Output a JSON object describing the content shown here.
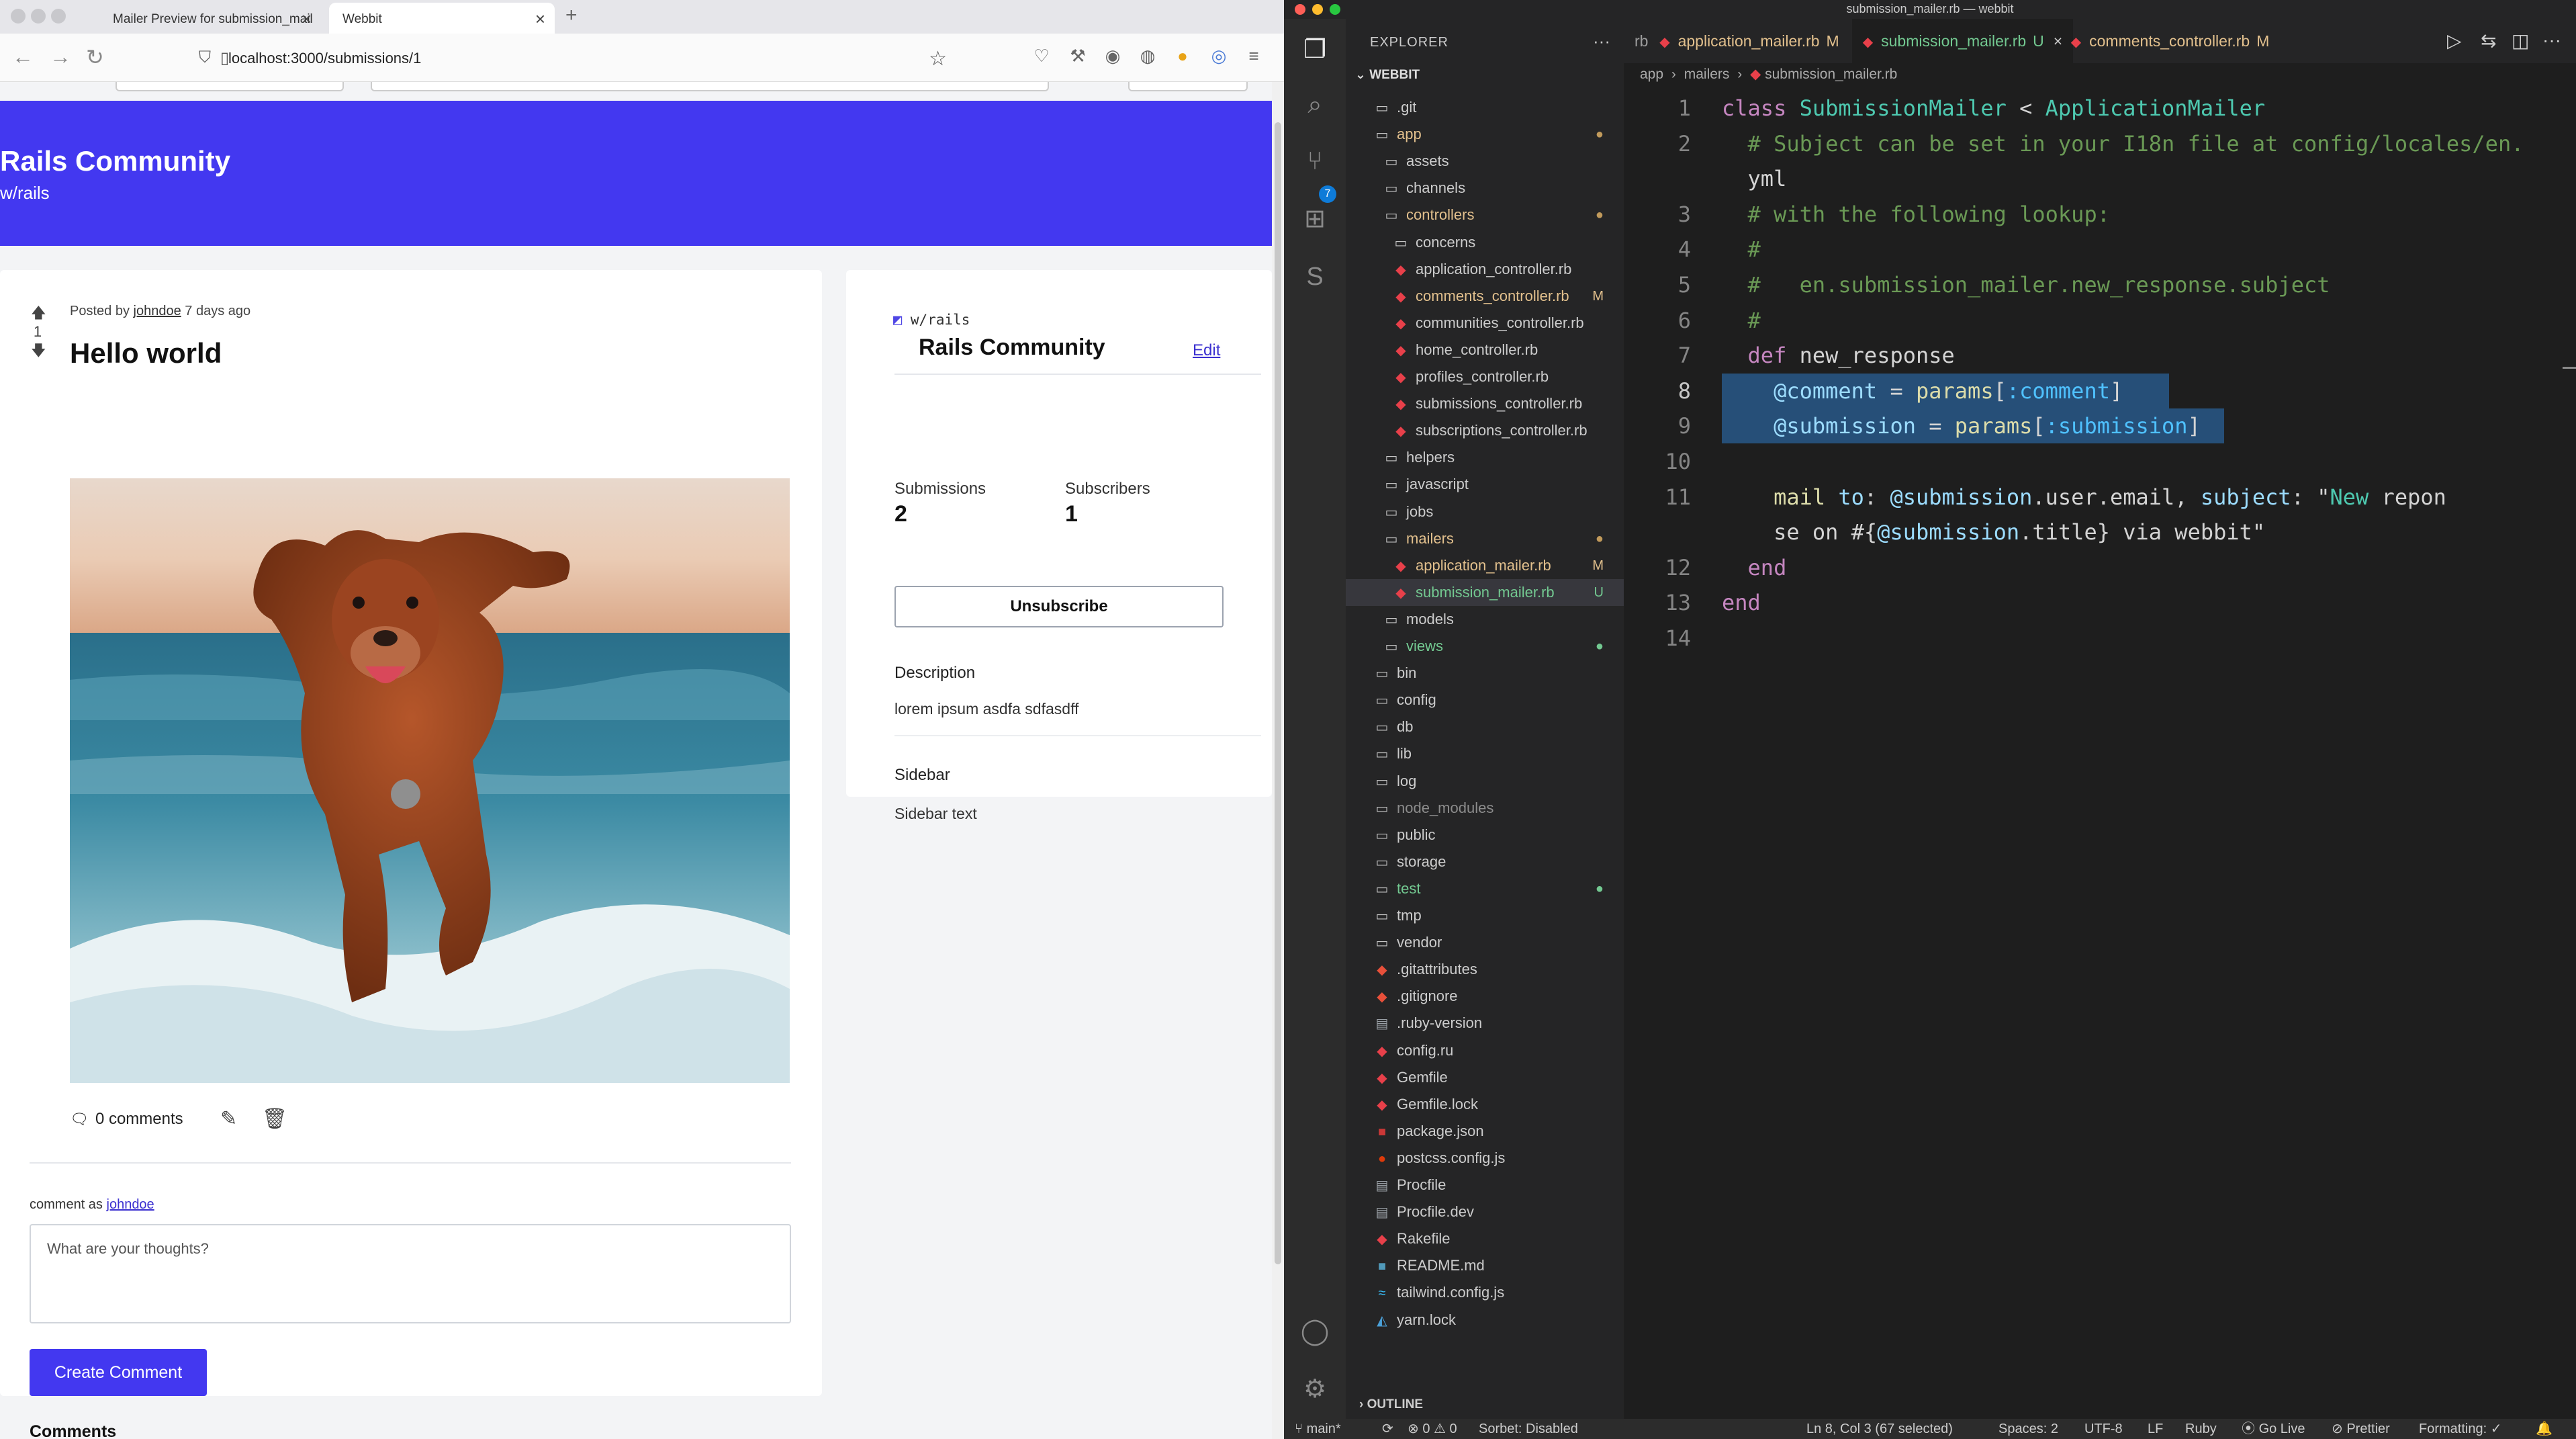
{
  "browser": {
    "tabs": [
      {
        "title": "Mailer Preview for submission_mail"
      },
      {
        "title": "Webbit"
      }
    ],
    "url": "localhost:3000/submissions/1"
  },
  "site": {
    "community_name": "Rails Community",
    "community_slug": "w/rails"
  },
  "post": {
    "posted_by_prefix": "Posted by",
    "author": "johndoe",
    "posted_time": "7 days ago",
    "votes": "1",
    "title": "Hello world",
    "comments_count": "0 comments",
    "comment_as_prefix": "comment as",
    "comment_placeholder": "What are your thoughts?",
    "create_comment_label": "Create Comment",
    "comments_heading": "Comments"
  },
  "community_card": {
    "slug": "w/rails",
    "name": "Rails Community",
    "edit_label": "Edit",
    "submissions_label": "Submissions",
    "submissions_value": "2",
    "subscribers_label": "Subscribers",
    "subscribers_value": "1",
    "unsubscribe_label": "Unsubscribe",
    "description_label": "Description",
    "description_text": "lorem ipsum asdfa sdfasdff",
    "sidebar_label": "Sidebar",
    "sidebar_text": "Sidebar text"
  },
  "vscode": {
    "window_title": "submission_mailer.rb — webbit",
    "explorer_title": "EXPLORER",
    "root_folder": "WEBBIT",
    "scm_badge": "7",
    "tree": [
      {
        "name": ".git",
        "type": "folder",
        "depth": 0,
        "color": "#cccccc"
      },
      {
        "name": "app",
        "type": "folder-open",
        "depth": 0,
        "color": "#e2c08d",
        "badge": "●",
        "badge_color": "#c19a5b"
      },
      {
        "name": "assets",
        "type": "folder",
        "depth": 1,
        "color": "#cccccc"
      },
      {
        "name": "channels",
        "type": "folder",
        "depth": 1,
        "color": "#cccccc"
      },
      {
        "name": "controllers",
        "type": "folder-open",
        "depth": 1,
        "color": "#e2c08d",
        "badge": "●",
        "badge_color": "#c19a5b"
      },
      {
        "name": "concerns",
        "type": "folder",
        "depth": 2,
        "color": "#cccccc"
      },
      {
        "name": "application_controller.rb",
        "type": "ruby",
        "depth": 2,
        "color": "#cccccc"
      },
      {
        "name": "comments_controller.rb",
        "type": "ruby",
        "depth": 2,
        "color": "#e2c08d",
        "badge": "M",
        "badge_color": "#e2c08d"
      },
      {
        "name": "communities_controller.rb",
        "type": "ruby",
        "depth": 2,
        "color": "#cccccc"
      },
      {
        "name": "home_controller.rb",
        "type": "ruby",
        "depth": 2,
        "color": "#cccccc"
      },
      {
        "name": "profiles_controller.rb",
        "type": "ruby",
        "depth": 2,
        "color": "#cccccc"
      },
      {
        "name": "submissions_controller.rb",
        "type": "ruby",
        "depth": 2,
        "color": "#cccccc"
      },
      {
        "name": "subscriptions_controller.rb",
        "type": "ruby",
        "depth": 2,
        "color": "#cccccc"
      },
      {
        "name": "helpers",
        "type": "folder",
        "depth": 1,
        "color": "#cccccc"
      },
      {
        "name": "javascript",
        "type": "folder",
        "depth": 1,
        "color": "#cccccc"
      },
      {
        "name": "jobs",
        "type": "folder",
        "depth": 1,
        "color": "#cccccc"
      },
      {
        "name": "mailers",
        "type": "folder-open",
        "depth": 1,
        "color": "#e2c08d",
        "badge": "●",
        "badge_color": "#c19a5b"
      },
      {
        "name": "application_mailer.rb",
        "type": "ruby",
        "depth": 2,
        "color": "#e2c08d",
        "badge": "M",
        "badge_color": "#e2c08d"
      },
      {
        "name": "submission_mailer.rb",
        "type": "ruby",
        "depth": 2,
        "color": "#73c991",
        "badge": "U",
        "badge_color": "#73c991",
        "selected": true
      },
      {
        "name": "models",
        "type": "folder",
        "depth": 1,
        "color": "#cccccc"
      },
      {
        "name": "views",
        "type": "folder",
        "depth": 1,
        "color": "#73c991",
        "badge": "●",
        "badge_color": "#73c991"
      },
      {
        "name": "bin",
        "type": "folder",
        "depth": 0,
        "color": "#cccccc"
      },
      {
        "name": "config",
        "type": "folder",
        "depth": 0,
        "color": "#cccccc"
      },
      {
        "name": "db",
        "type": "folder",
        "depth": 0,
        "color": "#cccccc"
      },
      {
        "name": "lib",
        "type": "folder",
        "depth": 0,
        "color": "#cccccc"
      },
      {
        "name": "log",
        "type": "folder",
        "depth": 0,
        "color": "#cccccc"
      },
      {
        "name": "node_modules",
        "type": "folder",
        "depth": 0,
        "color": "#8c8c8c"
      },
      {
        "name": "public",
        "type": "folder",
        "depth": 0,
        "color": "#cccccc"
      },
      {
        "name": "storage",
        "type": "folder",
        "depth": 0,
        "color": "#cccccc"
      },
      {
        "name": "test",
        "type": "folder",
        "depth": 0,
        "color": "#73c991",
        "badge": "●",
        "badge_color": "#73c991"
      },
      {
        "name": "tmp",
        "type": "folder",
        "depth": 0,
        "color": "#cccccc"
      },
      {
        "name": "vendor",
        "type": "folder",
        "depth": 0,
        "color": "#cccccc"
      },
      {
        "name": ".gitattributes",
        "type": "git",
        "depth": 0,
        "color": "#cccccc"
      },
      {
        "name": ".gitignore",
        "type": "git",
        "depth": 0,
        "color": "#cccccc"
      },
      {
        "name": ".ruby-version",
        "type": "file",
        "depth": 0,
        "color": "#cccccc"
      },
      {
        "name": "config.ru",
        "type": "ruby",
        "depth": 0,
        "color": "#cccccc"
      },
      {
        "name": "Gemfile",
        "type": "ruby",
        "depth": 0,
        "color": "#cccccc"
      },
      {
        "name": "Gemfile.lock",
        "type": "ruby",
        "depth": 0,
        "color": "#cccccc"
      },
      {
        "name": "package.json",
        "type": "npm",
        "depth": 0,
        "color": "#cccccc"
      },
      {
        "name": "postcss.config.js",
        "type": "postcss",
        "depth": 0,
        "color": "#cccccc"
      },
      {
        "name": "Procfile",
        "type": "file",
        "depth": 0,
        "color": "#cccccc"
      },
      {
        "name": "Procfile.dev",
        "type": "file",
        "depth": 0,
        "color": "#cccccc"
      },
      {
        "name": "Rakefile",
        "type": "ruby",
        "depth": 0,
        "color": "#cccccc"
      },
      {
        "name": "README.md",
        "type": "readme",
        "depth": 0,
        "color": "#cccccc"
      },
      {
        "name": "tailwind.config.js",
        "type": "tailwind",
        "depth": 0,
        "color": "#cccccc"
      },
      {
        "name": "yarn.lock",
        "type": "yarn",
        "depth": 0,
        "color": "#cccccc"
      }
    ],
    "outline_label": "OUTLINE",
    "editor_tabs": [
      {
        "name": "rb",
        "status": "",
        "color": "#9d9d9d"
      },
      {
        "name": "application_mailer.rb",
        "status": "M",
        "color": "#e2c08d"
      },
      {
        "name": "submission_mailer.rb",
        "status": "U",
        "color": "#73c991",
        "active": true
      },
      {
        "name": "comments_controller.rb",
        "status": "M",
        "color": "#e2c08d"
      }
    ],
    "breadcrumb": [
      "app",
      "mailers",
      "submission_mailer.rb"
    ],
    "code_lines": [
      "class SubmissionMailer < ApplicationMailer",
      "  # Subject can be set in your I18n file at config/locales/en.yml",
      "  # with the following lookup:",
      "  #",
      "  #   en.submission_mailer.new_response.subject",
      "  #",
      "  def new_response",
      "    @comment = params[:comment]",
      "    @submission = params[:submission]",
      "",
      "    mail to: @submission.user.email, subject: \"New reponse on #{@submission.title} via webbit\"",
      "  end",
      "end",
      ""
    ],
    "line_numbers": [
      "1",
      "2",
      "",
      "3",
      "4",
      "5",
      "6",
      "7",
      "8",
      "9",
      "10",
      "11",
      "",
      "12",
      "13",
      "14"
    ],
    "status": {
      "branch": "main*",
      "problems": "⊗ 0 ⚠ 0",
      "sorbet": "Sorbet: Disabled",
      "cursor": "Ln 8, Col 3 (67 selected)",
      "spaces": "Spaces: 2",
      "encoding": "UTF-8",
      "eol": "LF",
      "language": "Ruby",
      "golive": "Go Live",
      "prettier": "Prettier",
      "formatting": "Formatting: ✓"
    }
  }
}
